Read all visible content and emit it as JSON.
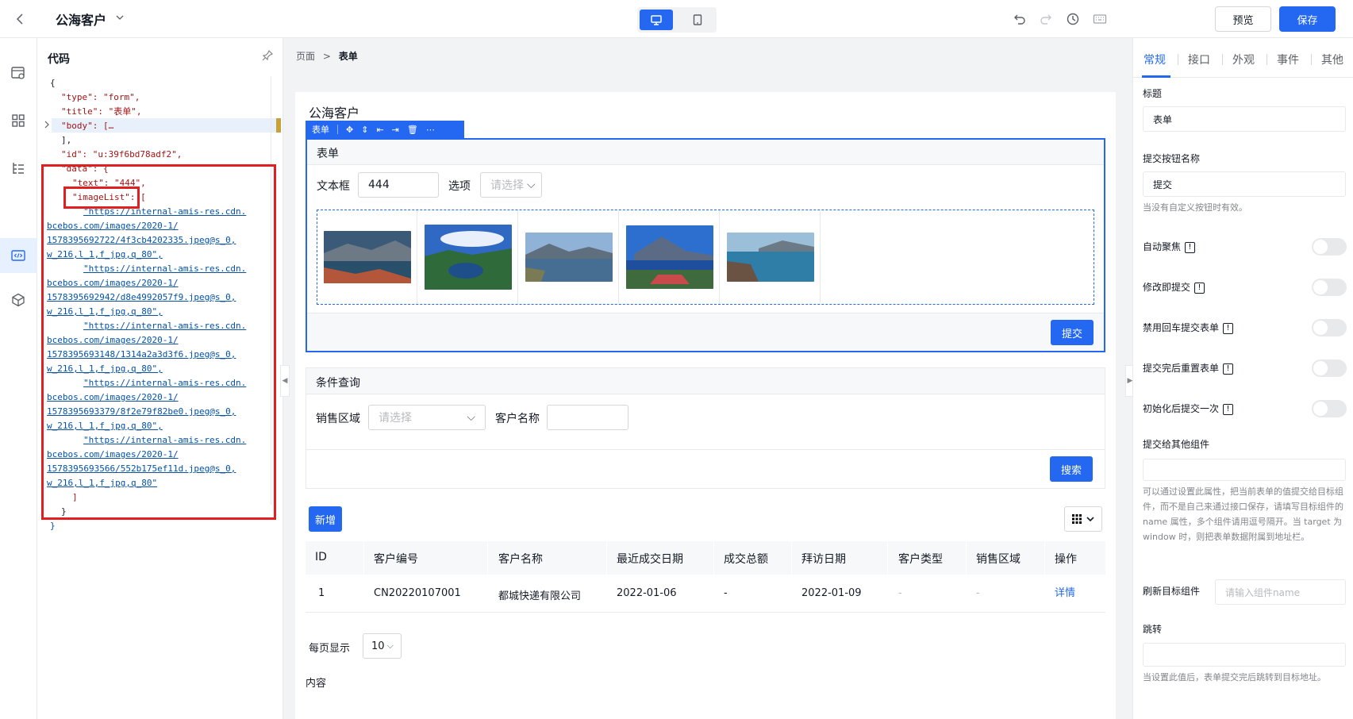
{
  "header": {
    "app_title": "公海客户",
    "preview_label": "预览",
    "save_label": "保存"
  },
  "code_panel": {
    "title": "代码",
    "lines": [
      "{",
      "\"type\": \"form\",",
      "\"title\": \"表单\",",
      "\"body\": […",
      "],",
      "\"id\": \"u:39f6bd78adf2\",",
      "\"data\": {",
      "\"text\": \"444\",",
      "\"imageList\": [",
      "\"https://internal-amis-res.cdn.",
      "bcebos.com/images/2020-1/",
      "1578395692722/4f3cb4202335.jpeg@s_0,",
      "w_216,l_1,f_jpg,q_80\",",
      "\"https://internal-amis-res.cdn.",
      "bcebos.com/images/2020-1/",
      "1578395692942/d8e4992057f9.jpeg@s_0,",
      "w_216,l_1,f_jpg,q_80\",",
      "\"https://internal-amis-res.cdn.",
      "bcebos.com/images/2020-1/",
      "1578395693148/1314a2a3d3f6.jpeg@s_0,",
      "w_216,l_1,f_jpg,q_80\",",
      "\"https://internal-amis-res.cdn.",
      "bcebos.com/images/2020-1/",
      "1578395693379/8f2e79f82be0.jpeg@s_0,",
      "w_216,l_1,f_jpg,q_80\",",
      "\"https://internal-amis-res.cdn.",
      "bcebos.com/images/2020-1/",
      "1578395693566/552b175ef11d.jpeg@s_0,",
      "w_216,l_1,f_jpg,q_80\"",
      "]",
      "}",
      "}"
    ]
  },
  "breadcrumb": {
    "root": "页面",
    "sep": ">",
    "current": "表单"
  },
  "page": {
    "title": "公海客户",
    "toolbar_label": "表单"
  },
  "form": {
    "title": "表单",
    "text_label": "文本框",
    "text_value": "444",
    "select_label": "选项",
    "select_placeholder": "请选择",
    "submit_label": "提交"
  },
  "query": {
    "title": "条件查询",
    "region_label": "销售区域",
    "region_placeholder": "请选择",
    "name_label": "客户名称",
    "search_label": "搜索"
  },
  "crud": {
    "add_label": "新增",
    "columns": [
      "ID",
      "客户编号",
      "客户名称",
      "最近成交日期",
      "成交总额",
      "拜访日期",
      "客户类型",
      "销售区域",
      "操作"
    ],
    "rows": [
      [
        "1",
        "CN20220107001",
        "都城快递有限公司",
        "2022-01-06",
        "-",
        "2022-01-09",
        "-",
        "-",
        "详情"
      ]
    ],
    "per_page_label": "每页显示",
    "per_page_value": "10",
    "content_label": "内容"
  },
  "right_panel": {
    "tabs": [
      "常规",
      "接口",
      "外观",
      "事件",
      "其他"
    ],
    "title_label": "标题",
    "title_value": "表单",
    "submit_text_label": "提交按钮名称",
    "submit_text_value": "提交",
    "submit_text_hint": "当没有自定义按钮时有效。",
    "autofocus_label": "自动聚焦",
    "submit_on_change_label": "修改即提交",
    "prevent_enter_label": "禁用回车提交表单",
    "reset_after_submit_label": "提交完后重置表单",
    "submit_on_init_label": "初始化后提交一次",
    "target_label": "提交给其他组件",
    "target_hint": "可以通过设置此属性，把当前表单的值提交给目标组件，而不是自己来通过接口保存，请填写目标组件的 name 属性，多个组件请用逗号隔开。当 target 为 window 时，则把表单数据附属到地址栏。",
    "reload_label": "刷新目标组件",
    "reload_placeholder": "请输入组件name",
    "redirect_label": "跳转",
    "redirect_hint": "当设置此值后，表单提交完后跳转到目标地址。"
  },
  "colors": {
    "primary": "#2468f2",
    "highlight_border": "#e02020"
  }
}
